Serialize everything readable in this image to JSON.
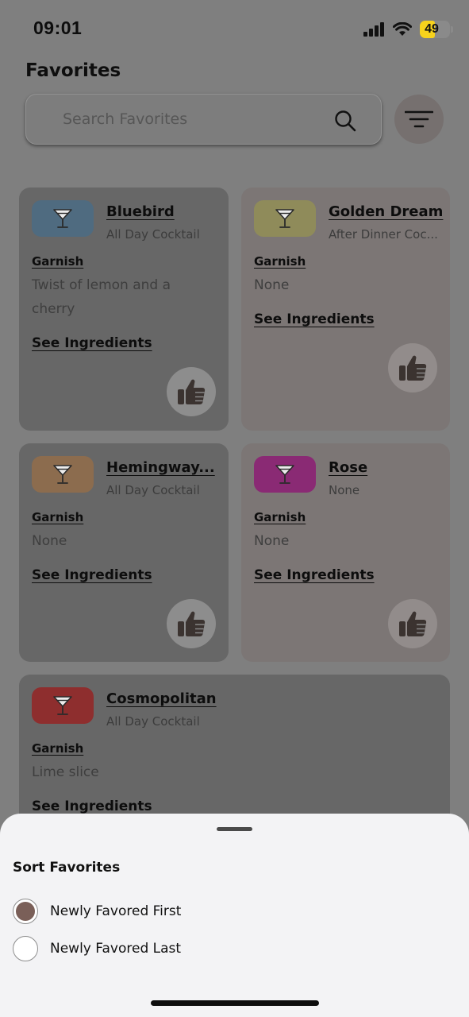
{
  "status_bar": {
    "time": "09:01",
    "battery_level": "49",
    "battery_fraction": 0.49,
    "icons": [
      "cellular-signal-icon",
      "wifi-icon",
      "battery-icon"
    ]
  },
  "page_title": "Favorites",
  "search": {
    "placeholder": "Search Favorites",
    "value": ""
  },
  "colors": {
    "overlay_background": "#7f7f7f",
    "card_dark": "#676767",
    "card_light": "#7c7675",
    "sheet_background": "#f3f3f5",
    "selected_radio": "#7a5f58"
  },
  "cards": [
    {
      "name": "Bluebird",
      "category": "All Day Cocktail",
      "garnish_label": "Garnish",
      "garnish": "Twist of lemon and a cherry",
      "link_label": "See Ingredients",
      "thumb_color": "#4f6b80",
      "icon": "cocktail-glass-icon",
      "like_icon": "thumbs-up-icon"
    },
    {
      "name": "Golden Dream",
      "category": "After Dinner Coc...",
      "garnish_label": "Garnish",
      "garnish": "None",
      "link_label": "See Ingredients",
      "thumb_color": "#8f8b5a",
      "icon": "cocktail-glass-icon",
      "like_icon": "thumbs-up-icon"
    },
    {
      "name": "Hemingway...",
      "category": "All Day Cocktail",
      "garnish_label": "Garnish",
      "garnish": "None",
      "link_label": "See Ingredients",
      "thumb_color": "#8c6c4e",
      "icon": "cocktail-glass-icon",
      "like_icon": "thumbs-up-icon"
    },
    {
      "name": "Rose",
      "category": "None",
      "garnish_label": "Garnish",
      "garnish": "None",
      "link_label": "See Ingredients",
      "thumb_color": "#8a2a74",
      "icon": "cocktail-glass-icon",
      "like_icon": "thumbs-up-icon"
    },
    {
      "name": "Cosmopolitan",
      "category": "All Day Cocktail",
      "garnish_label": "Garnish",
      "garnish": "Lime slice",
      "link_label": "See Ingredients",
      "thumb_color": "#8e2e2e",
      "icon": "cocktail-glass-icon",
      "like_icon": "thumbs-up-icon"
    }
  ],
  "sort_sheet": {
    "title": "Sort Favorites",
    "options": [
      {
        "label": "Newly Favored First",
        "selected": true
      },
      {
        "label": "Newly Favored Last",
        "selected": false
      }
    ]
  }
}
